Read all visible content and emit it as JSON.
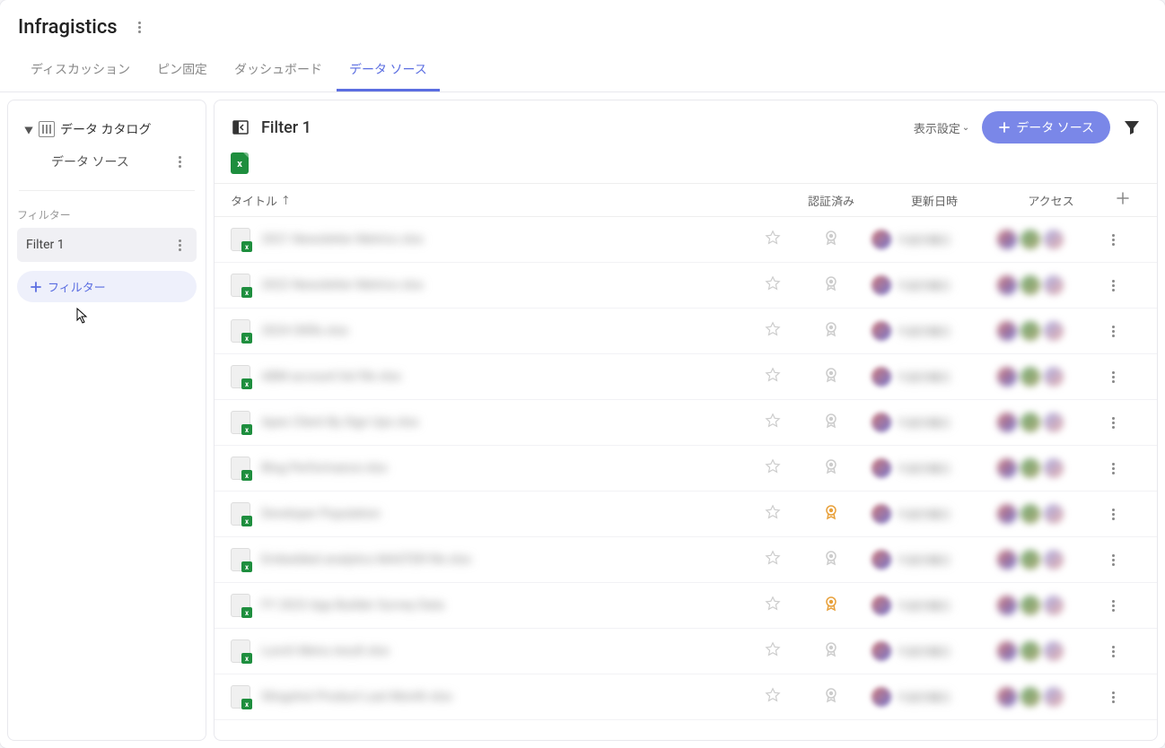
{
  "header": {
    "app_title": "Infragistics",
    "tabs": [
      "ディスカッション",
      "ピン固定",
      "ダッシュボード",
      "データ ソース"
    ],
    "active_tab_index": 3
  },
  "sidebar": {
    "catalog_label": "データ カタログ",
    "data_source_label": "データ ソース",
    "filter_section_label": "フィルター",
    "filters": [
      "Filter 1"
    ],
    "add_filter_label": "フィルター"
  },
  "main": {
    "title": "Filter 1",
    "display_settings_label": "表示設定",
    "add_button_label": "データ ソース",
    "columns": {
      "title": "タイトル",
      "certified": "認証済み",
      "updated": "更新日時",
      "access": "アクセス"
    },
    "rows": [
      {
        "title": "2021 Newsletter Metrics xlsx",
        "certified": false
      },
      {
        "title": "2022 Newsletter Metrics xlsx",
        "certified": false
      },
      {
        "title": "2024 OKRs xlsx",
        "certified": false
      },
      {
        "title": "ABM account list file xlsx",
        "certified": false
      },
      {
        "title": "Apex Client By Sign Ups xlsx",
        "certified": false
      },
      {
        "title": "Blog Performance xlsx",
        "certified": false
      },
      {
        "title": "Developer Population",
        "certified": true
      },
      {
        "title": "Embedded analytics MASTER file xlsx",
        "certified": false
      },
      {
        "title": "FY 2023 App Builder Survey Data",
        "certified": true
      },
      {
        "title": "Lunch Menu result xlsx",
        "certified": false
      },
      {
        "title": "Slingshot Product Last Month xlsx",
        "certified": false
      }
    ]
  }
}
